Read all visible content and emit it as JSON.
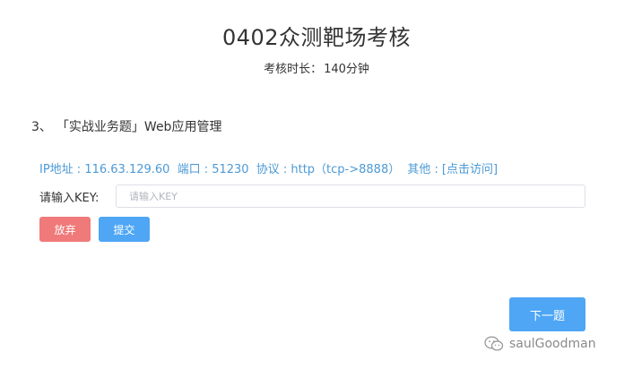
{
  "header": {
    "title": "0402众测靶场考核",
    "duration_label": "考核时长：",
    "duration_value": "140分钟"
  },
  "question": {
    "number": "3、",
    "title": "「实战业务题」Web应用管理"
  },
  "target": {
    "ip": "IP地址 : 116.63.129.60",
    "port": "端口 : 51230",
    "protocol": "协议 : http（tcp->8888）",
    "other_label": "其他 :",
    "visit_link": "[点击访问]"
  },
  "key_form": {
    "label": "请输入KEY:",
    "placeholder": "请输入KEY",
    "value": ""
  },
  "buttons": {
    "abandon": "放弃",
    "submit": "提交",
    "next": "下一题"
  },
  "watermark": {
    "text": "saulGoodman"
  },
  "colors": {
    "primary": "#4ea6f5",
    "danger": "#f07a7a",
    "link": "#4c9ad5"
  }
}
